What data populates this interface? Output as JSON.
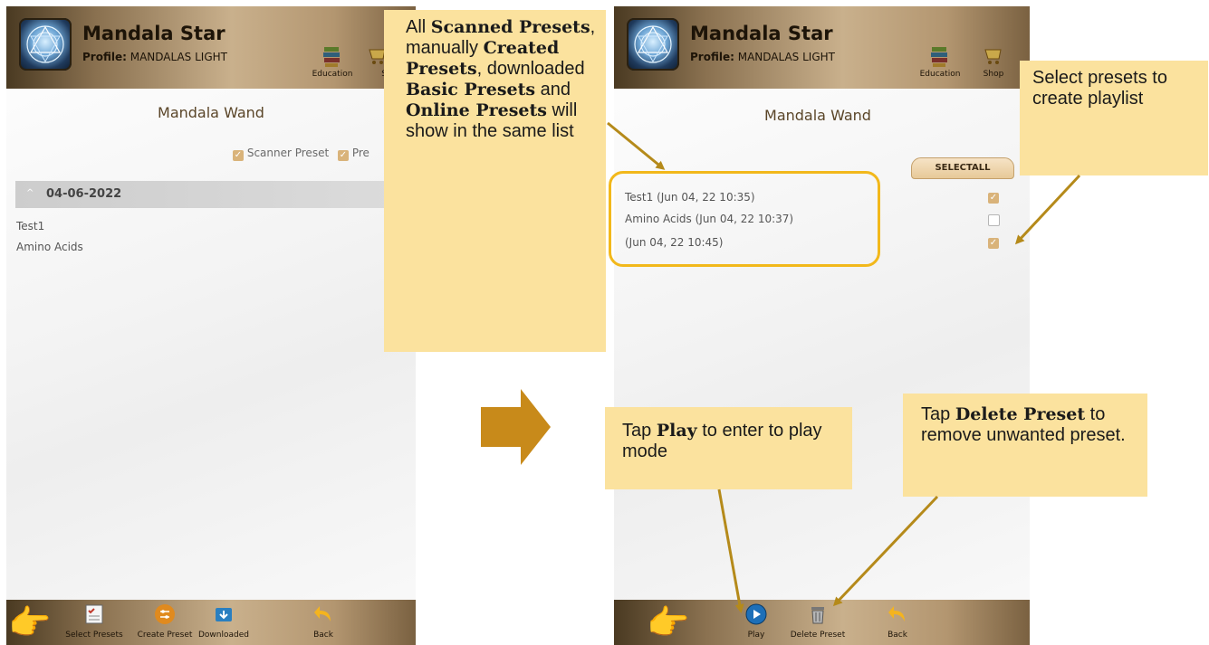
{
  "left_screen": {
    "app_title": "Mandala Star",
    "profile_label": "Profile:",
    "profile_value": "MANDALAS LIGHT",
    "nav": {
      "education": "Education",
      "shop_partial": "S"
    },
    "page_title": "Mandala Wand",
    "filters": {
      "scanner": "Scanner Preset",
      "second_partial": "Pre"
    },
    "date_group": "04-06-2022",
    "items": [
      "Test1",
      "Amino Acids"
    ],
    "bottom_bar": {
      "select_presets": "Select Presets",
      "create_preset": "Create Preset",
      "downloaded": "Downloaded",
      "back": "Back"
    }
  },
  "right_screen": {
    "app_title": "Mandala Star",
    "profile_label": "Profile:",
    "profile_value": "MANDALAS LIGHT",
    "nav": {
      "education": "Education",
      "shop": "Shop"
    },
    "page_title": "Mandala Wand",
    "select_all": "SELECTALL",
    "presets": [
      {
        "label": "Test1 (Jun 04, 22 10:35)",
        "checked": true
      },
      {
        "label": "Amino Acids (Jun 04, 22 10:37)",
        "checked": false
      },
      {
        "label": " (Jun 04, 22 10:45)",
        "checked": true
      }
    ],
    "bottom_bar": {
      "play": "Play",
      "delete_preset": "Delete Preset",
      "back": "Back"
    }
  },
  "callouts": {
    "presets_list": {
      "t1": "All ",
      "b1": "Scanned Presets",
      "t2": ", manually ",
      "b2": "Created Presets",
      "t3": ", downloaded ",
      "b3": "Basic Presets",
      "t4": " and ",
      "b4": "Online Presets",
      "t5": " will show in the same list"
    },
    "select": {
      "text": "Select presets to create playlist"
    },
    "play": {
      "t1": "Tap ",
      "b1": "Play",
      "t2": " to enter to play mode"
    },
    "delete": {
      "t1": "Tap ",
      "b1": "Delete Preset",
      "t2": " to remove unwanted preset."
    }
  },
  "colors": {
    "accent_gold": "#f2b81b",
    "callout_bg": "#fbe29e",
    "arrow": "#b58a1a",
    "checkbox": "#d9b37a"
  }
}
